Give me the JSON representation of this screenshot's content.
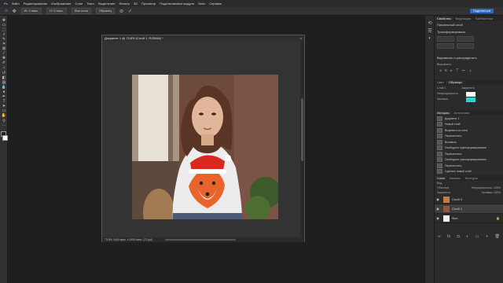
{
  "app": {
    "logo": "Ps"
  },
  "menu": [
    "Файл",
    "Редактирование",
    "Изображение",
    "Слои",
    "Текст",
    "Выделение",
    "Фильтр",
    "3D",
    "Просмотр",
    "Подключаемые модули",
    "Окно",
    "Справка"
  ],
  "options_bar": {
    "fields": [
      "W: 0 пикс.",
      "H: 0 пикс.",
      "Все слои",
      "Образец"
    ],
    "share_label": "Поделиться"
  },
  "toolbar": {
    "tools": [
      "move-icon",
      "artboard-icon",
      "marquee-icon",
      "lasso-icon",
      "quick-select-icon",
      "crop-icon",
      "frame-icon",
      "eyedropper-icon",
      "healing-icon",
      "brush-icon",
      "stamp-icon",
      "history-brush-icon",
      "eraser-icon",
      "gradient-icon",
      "blur-icon",
      "dodge-icon",
      "pen-icon",
      "type-icon",
      "path-select-icon",
      "shape-icon",
      "hand-icon",
      "zoom-icon",
      "more-icon"
    ]
  },
  "document": {
    "title": "Документ 1 @ 73,6% (Слой 1, RGB/8#) *",
    "status": "73,6%    1400 пикс. x 1400 пикс. (72 ppi)"
  },
  "properties_panel": {
    "tabs": [
      "Свойства",
      "Коррекция",
      "Библиотеки"
    ],
    "doc_label": "Пиксельный слой",
    "transform_label": "Трансформировать",
    "align_label": "Выровнять и распределить",
    "align_sub": "Выровнять:"
  },
  "color_panel": {
    "tabs": [
      "Цвет",
      "Образцы"
    ],
    "rows": [
      "Слой 1",
      "Непрозрачность:",
      "Заливка:"
    ],
    "right_label": "Закрепить:",
    "accent": "#29d4d4"
  },
  "history_panel": {
    "tabs": [
      "История",
      "Источники"
    ],
    "items": [
      "Документ 1",
      "Новый слой",
      "Вырезать из слоя",
      "Переместить",
      "Вставить",
      "Свободное трансформирование",
      "Переместить",
      "Свободное трансформирование",
      "Переместить",
      "Сделать новый слой",
      "Удалить слой",
      "Свободное трансформирование",
      "Заливка",
      "Переместить"
    ]
  },
  "layers_panel": {
    "tabs": [
      "Слои",
      "Каналы",
      "Контуры"
    ],
    "kind_label": "Вид",
    "mode_label": "Обычные",
    "opacity_label": "Непрозрачность: 100%",
    "lock_label": "Закрепить:",
    "fill_label": "Заливка: 100%",
    "layers": [
      {
        "name": "Слой 2",
        "thumb": "#c87a3c"
      },
      {
        "name": "Слой 1",
        "thumb": "#8a5a46"
      },
      {
        "name": "Фон",
        "thumb": "#f0f0f0"
      }
    ]
  }
}
